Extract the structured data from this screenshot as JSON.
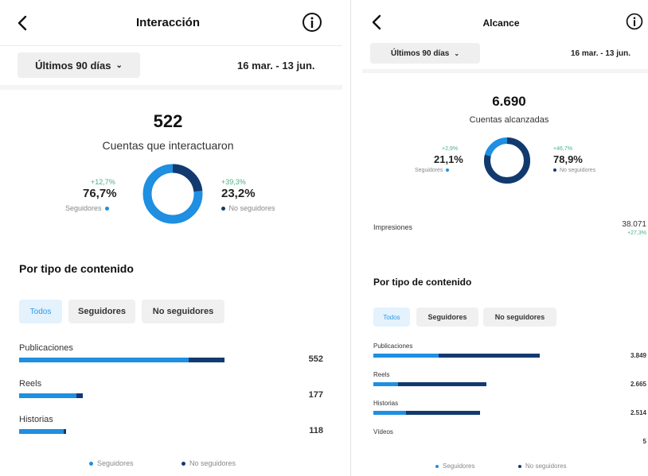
{
  "colors": {
    "followers": "#1e8fe1",
    "non_followers": "#123a6e",
    "positive_change": "#4caf84"
  },
  "left": {
    "title": "Interacción",
    "range_button": "Últimos 90 días",
    "date_range": "16 mar. - 13 jun.",
    "total": "522",
    "total_label": "Cuentas que interactuaron",
    "followers": {
      "change": "+12,7%",
      "pct": "76,7%",
      "label": "Seguidores",
      "share": 0.767
    },
    "non_followers": {
      "change": "+39,3%",
      "pct": "23,2%",
      "label": "No seguidores",
      "share": 0.232
    },
    "section_title": "Por tipo de contenido",
    "chips": [
      "Todos",
      "Seguidores",
      "No seguidores"
    ],
    "rows": [
      {
        "label": "Publicaciones",
        "value": "552",
        "followers": 0.8,
        "non_followers": 0.17
      },
      {
        "label": "Reels",
        "value": "177",
        "followers": 0.27,
        "non_followers": 0.03
      },
      {
        "label": "Historias",
        "value": "118",
        "followers": 0.21,
        "non_followers": 0.01
      }
    ],
    "legend": {
      "followers": "Seguidores",
      "non_followers": "No seguidores"
    }
  },
  "right": {
    "title": "Alcance",
    "range_button": "Últimos 90 días",
    "date_range": "16 mar. - 13 jun.",
    "total": "6.690",
    "total_label": "Cuentas alcanzadas",
    "followers": {
      "change": "+2,9%",
      "pct": "21,1%",
      "label": "Seguidores",
      "share": 0.211
    },
    "non_followers": {
      "change": "+46,7%",
      "pct": "78,9%",
      "label": "No seguidores",
      "share": 0.789
    },
    "impressions_label": "Impresiones",
    "impressions_value": "38.071",
    "impressions_change": "+27,3%",
    "section_title": "Por tipo de contenido",
    "chips": [
      "Todos",
      "Seguidores",
      "No seguidores"
    ],
    "rows": [
      {
        "label": "Publicaciones",
        "value": "3.849",
        "followers": 0.34,
        "non_followers": 0.53
      },
      {
        "label": "Reels",
        "value": "2.665",
        "followers": 0.13,
        "non_followers": 0.46
      },
      {
        "label": "Historias",
        "value": "2.514",
        "followers": 0.17,
        "non_followers": 0.39
      },
      {
        "label": "Vídeos",
        "value": "5",
        "followers": 0,
        "non_followers": 0
      }
    ],
    "legend": {
      "followers": "Seguidores",
      "non_followers": "No seguidores"
    }
  }
}
